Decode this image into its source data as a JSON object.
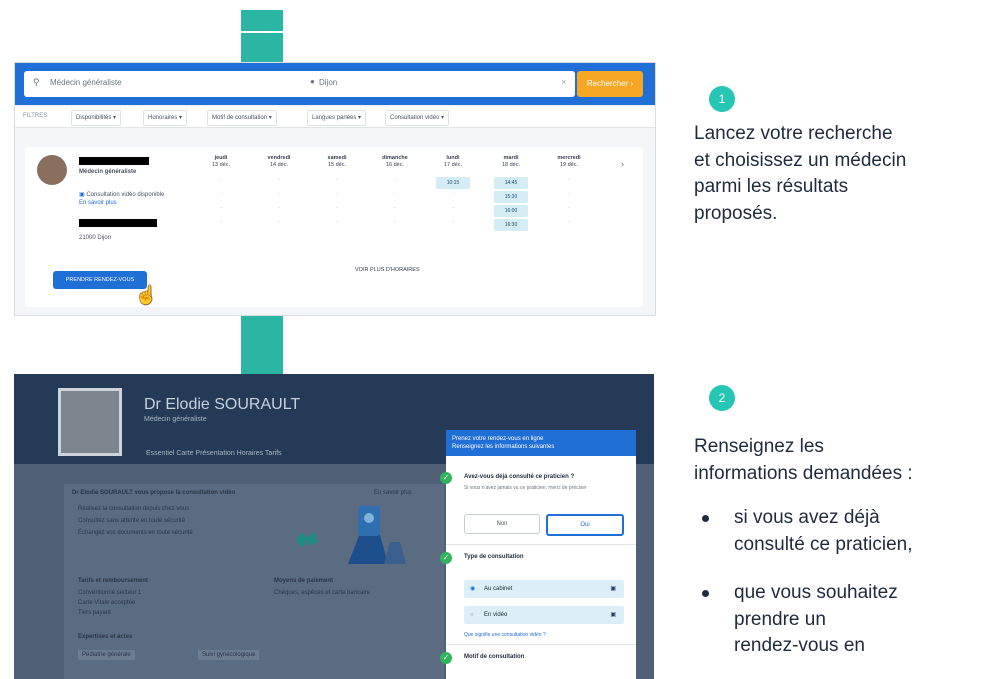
{
  "connectors": true,
  "shot1": {
    "search_placeholder": "Médecin généraliste",
    "location_text": "Dijon",
    "clear_glyph": "×",
    "search_button": "Rechercher",
    "filters_label": "FILTRES",
    "filters": [
      "Disponibilités",
      "Honoraires",
      "Motif de consultation",
      "Langues parlées",
      "Consultation vidéo"
    ],
    "doctor_specialty": "Médecin généraliste",
    "video_label": "Consultation vidéo disponible",
    "video_sub": "En savoir plus",
    "city": "21000 Dijon",
    "days": [
      {
        "day": "jeudi",
        "date": "13 déc."
      },
      {
        "day": "vendredi",
        "date": "14 déc."
      },
      {
        "day": "samedi",
        "date": "15 déc."
      },
      {
        "day": "dimanche",
        "date": "16 déc."
      },
      {
        "day": "lundi",
        "date": "17 déc."
      },
      {
        "day": "mardi",
        "date": "18 déc."
      },
      {
        "day": "mercredi",
        "date": "19 déc."
      }
    ],
    "slots": [
      {
        "col": 4,
        "row": 0,
        "time": "10:15"
      },
      {
        "col": 5,
        "row": 0,
        "time": "14:45"
      },
      {
        "col": 5,
        "row": 1,
        "time": "15:30"
      },
      {
        "col": 5,
        "row": 2,
        "time": "16:00"
      },
      {
        "col": 5,
        "row": 3,
        "time": "16:30"
      }
    ],
    "more_hours": "VOIR PLUS D'HORAIRES",
    "rdv_button": "PRENDRE RENDEZ-VOUS"
  },
  "shot2": {
    "doctor_name": "Dr Elodie SOURAULT",
    "specialty": "Médecin généraliste",
    "tabs": "Essentiel     Carte     Présentation     Horaires     Tarifs",
    "panel_title": "Dr Elodie SOURAULT vous propose la consultation vidéo",
    "panel_link": "En savoir plus",
    "panel_lines": [
      "Réalisez la consultation depuis chez vous",
      "Consultez sans attente en toute sécurité",
      "Échangez vos documents en toute sécurité"
    ],
    "section1": "Tarifs et remboursement",
    "section1_lines": [
      "Conventionné secteur 1",
      "Carte Vitale acceptée",
      "Tiers payant"
    ],
    "section2": "Moyens de paiement",
    "section2_line": "Chèques, espèces et carte bancaire",
    "section3": "Expertises et actes",
    "chips": [
      "Pédiatrie générale",
      "Suivi gynécologique"
    ],
    "form_header": "Prenez votre rendez-vous en ligne\nRenseignez les informations suivantes",
    "q1": "Avez-vous déjà consulté ce praticien ?",
    "q1_sub": "Si vous n'avez jamais vu ce praticien, merci de préciser",
    "opt_no": "Non",
    "opt_yes": "Oui",
    "q2": "Type de consultation",
    "opt_cabinet": "Au cabinet",
    "opt_video": "En vidéo",
    "q2_link": "Que signifie une consultation vidéo ?",
    "q3": "Motif de consultation"
  },
  "step1": {
    "number": "1",
    "lines": [
      "Lancez votre recherche",
      "et choisissez un médecin",
      "parmi les résultats",
      "proposés."
    ]
  },
  "step2": {
    "number": "2",
    "lines": [
      "Renseignez les",
      "informations demandées :"
    ],
    "bullets": [
      [
        "si vous avez déjà",
        "consulté ce praticien,"
      ],
      [
        "que vous souhaitez",
        "prendre un",
        "rendez-vous en"
      ]
    ]
  }
}
